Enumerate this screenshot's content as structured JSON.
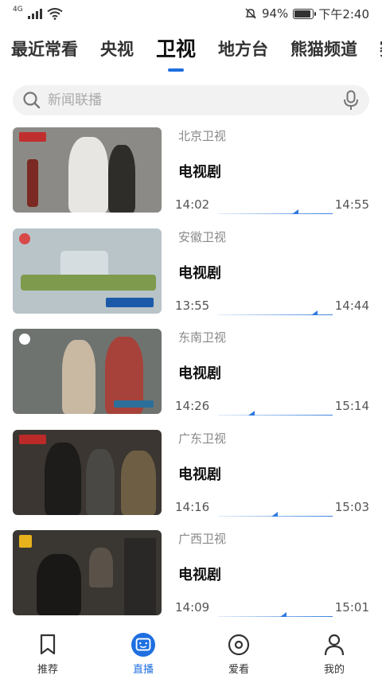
{
  "status_bar": {
    "network": "4G",
    "battery_percent": "94%",
    "battery_level": 0.94,
    "time": "下午2:40"
  },
  "tabs": [
    {
      "label": "最近常看",
      "active": false
    },
    {
      "label": "央视",
      "active": false
    },
    {
      "label": "卫视",
      "active": true
    },
    {
      "label": "地方台",
      "active": false
    },
    {
      "label": "熊猫频道",
      "active": false
    },
    {
      "label": "赛",
      "active": false
    }
  ],
  "search": {
    "placeholder": "新闻联播"
  },
  "channels": [
    {
      "name": "北京卫视",
      "program": "电视剧",
      "start": "14:02",
      "end": "14:55",
      "progress": 0.7,
      "thumb_color": "#8c8a86"
    },
    {
      "name": "安徽卫视",
      "program": "电视剧",
      "start": "13:55",
      "end": "14:44",
      "progress": 0.87,
      "thumb_color": "#b9c4c8"
    },
    {
      "name": "东南卫视",
      "program": "电视剧",
      "start": "14:26",
      "end": "15:14",
      "progress": 0.32,
      "thumb_color": "#6f7370"
    },
    {
      "name": "广东卫视",
      "program": "电视剧",
      "start": "14:16",
      "end": "15:03",
      "progress": 0.52,
      "thumb_color": "#3b3631"
    },
    {
      "name": "广西卫视",
      "program": "电视剧",
      "start": "14:09",
      "end": "15:01",
      "progress": 0.6,
      "thumb_color": "#3a3733"
    }
  ],
  "bottom_nav": [
    {
      "label": "推荐",
      "icon": "bookmark-icon",
      "active": false
    },
    {
      "label": "直播",
      "icon": "tv-face-icon",
      "active": true
    },
    {
      "label": "爱看",
      "icon": "record-icon",
      "active": false
    },
    {
      "label": "我的",
      "icon": "person-icon",
      "active": false
    }
  ],
  "colors": {
    "accent": "#1e6fe0"
  }
}
